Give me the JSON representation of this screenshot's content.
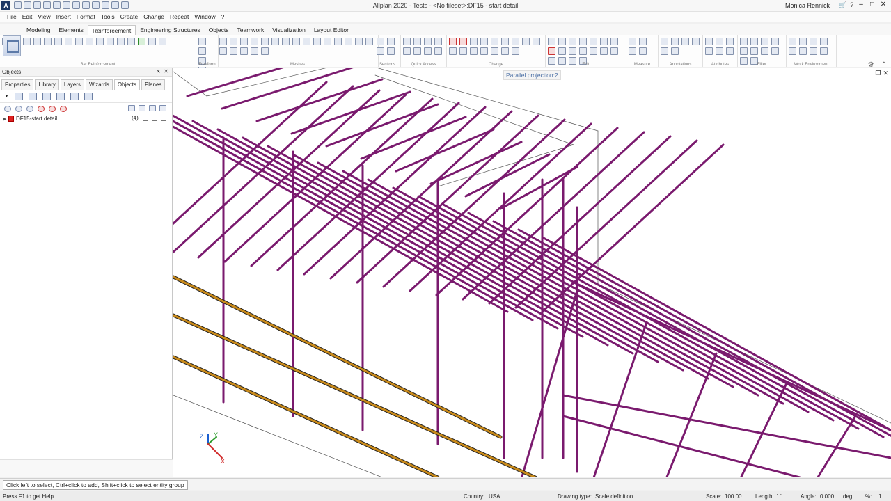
{
  "window": {
    "title": "Allplan 2020 - Tests - <No fileset>:DF15 - start detail",
    "user": "Monica Rennick",
    "logo": "A"
  },
  "menu": [
    "File",
    "Edit",
    "View",
    "Insert",
    "Format",
    "Tools",
    "Create",
    "Change",
    "Repeat",
    "Window",
    "?"
  ],
  "tabs": [
    "Modeling",
    "Elements",
    "Reinforcement",
    "Engineering Structures",
    "Objects",
    "Teamwork",
    "Visualization",
    "Layout Editor"
  ],
  "active_tab": "Reinforcement",
  "ribbon_groups": [
    {
      "label": "Bar Reinforcement"
    },
    {
      "label": "Freeform"
    },
    {
      "label": "Meshes"
    },
    {
      "label": "Sections"
    },
    {
      "label": "Quick Access"
    },
    {
      "label": "Change"
    },
    {
      "label": "Edit"
    },
    {
      "label": "Measure"
    },
    {
      "label": "Annotations"
    },
    {
      "label": "Attributes"
    },
    {
      "label": "Filter"
    },
    {
      "label": "Work Environment"
    }
  ],
  "panel": {
    "title": "Objects",
    "pin": "⨯",
    "close": "✕",
    "tabs": [
      "Properties",
      "Library",
      "Layers",
      "Wizards",
      "Objects",
      "Planes"
    ],
    "active_tab": "Objects",
    "tree": [
      {
        "label": "DF15-start detail",
        "count": "(4)"
      }
    ]
  },
  "viewport": {
    "view_label": "Parallel projection:2",
    "axis_x": "X",
    "axis_y": "Y",
    "axis_z": "Z"
  },
  "prompt": "Click left to select, Ctrl+click to add, Shift+click to select entity group",
  "status": {
    "help": "Press F1 to get Help.",
    "country_label": "Country:",
    "country": "USA",
    "drawing_type_label": "Drawing type:",
    "drawing_type": "Scale definition",
    "scale_label": "Scale:",
    "scale": "100.00",
    "length_label": "Length:",
    "length_unit": "' \"",
    "angle_label": "Angle:",
    "angle": "0.000",
    "angle_unit": "deg",
    "percent_label": "%:",
    "percent": "1"
  },
  "colors": {
    "rebar": "#7a1a6e",
    "longitudinal_bar": "#c98a1a",
    "accent": "#4a6fa5"
  }
}
